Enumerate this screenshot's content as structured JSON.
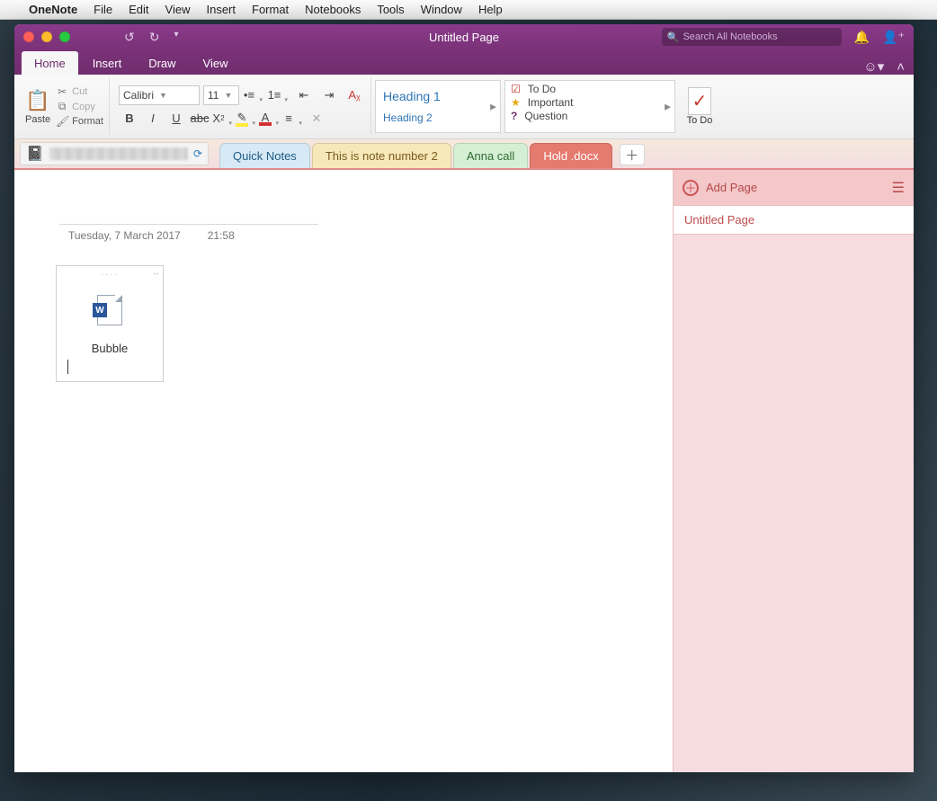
{
  "mac_menu": {
    "app": "OneNote",
    "items": [
      "File",
      "Edit",
      "View",
      "Insert",
      "Format",
      "Notebooks",
      "Tools",
      "Window",
      "Help"
    ]
  },
  "titlebar": {
    "title": "Untitled Page",
    "search_placeholder": "Search All Notebooks"
  },
  "ribbon_tabs": [
    "Home",
    "Insert",
    "Draw",
    "View"
  ],
  "ribbon": {
    "paste": "Paste",
    "cut": "Cut",
    "copy": "Copy",
    "format": "Format",
    "font_name": "Calibri",
    "font_size": "11",
    "heading1": "Heading 1",
    "heading2": "Heading 2",
    "tag_todo": "To Do",
    "tag_important": "Important",
    "tag_question": "Question",
    "todo_btn": "To Do"
  },
  "sections": [
    {
      "label": "Quick Notes",
      "color": "blue"
    },
    {
      "label": "This is note number 2",
      "color": "yellow"
    },
    {
      "label": "Anna call",
      "color": "green"
    },
    {
      "label": "Hold .docx",
      "color": "red",
      "active": true
    }
  ],
  "page": {
    "date": "Tuesday, 7 March 2017",
    "time": "21:58",
    "embed_name": "Bubble"
  },
  "pages_panel": {
    "add_page": "Add Page",
    "items": [
      "Untitled Page"
    ]
  }
}
